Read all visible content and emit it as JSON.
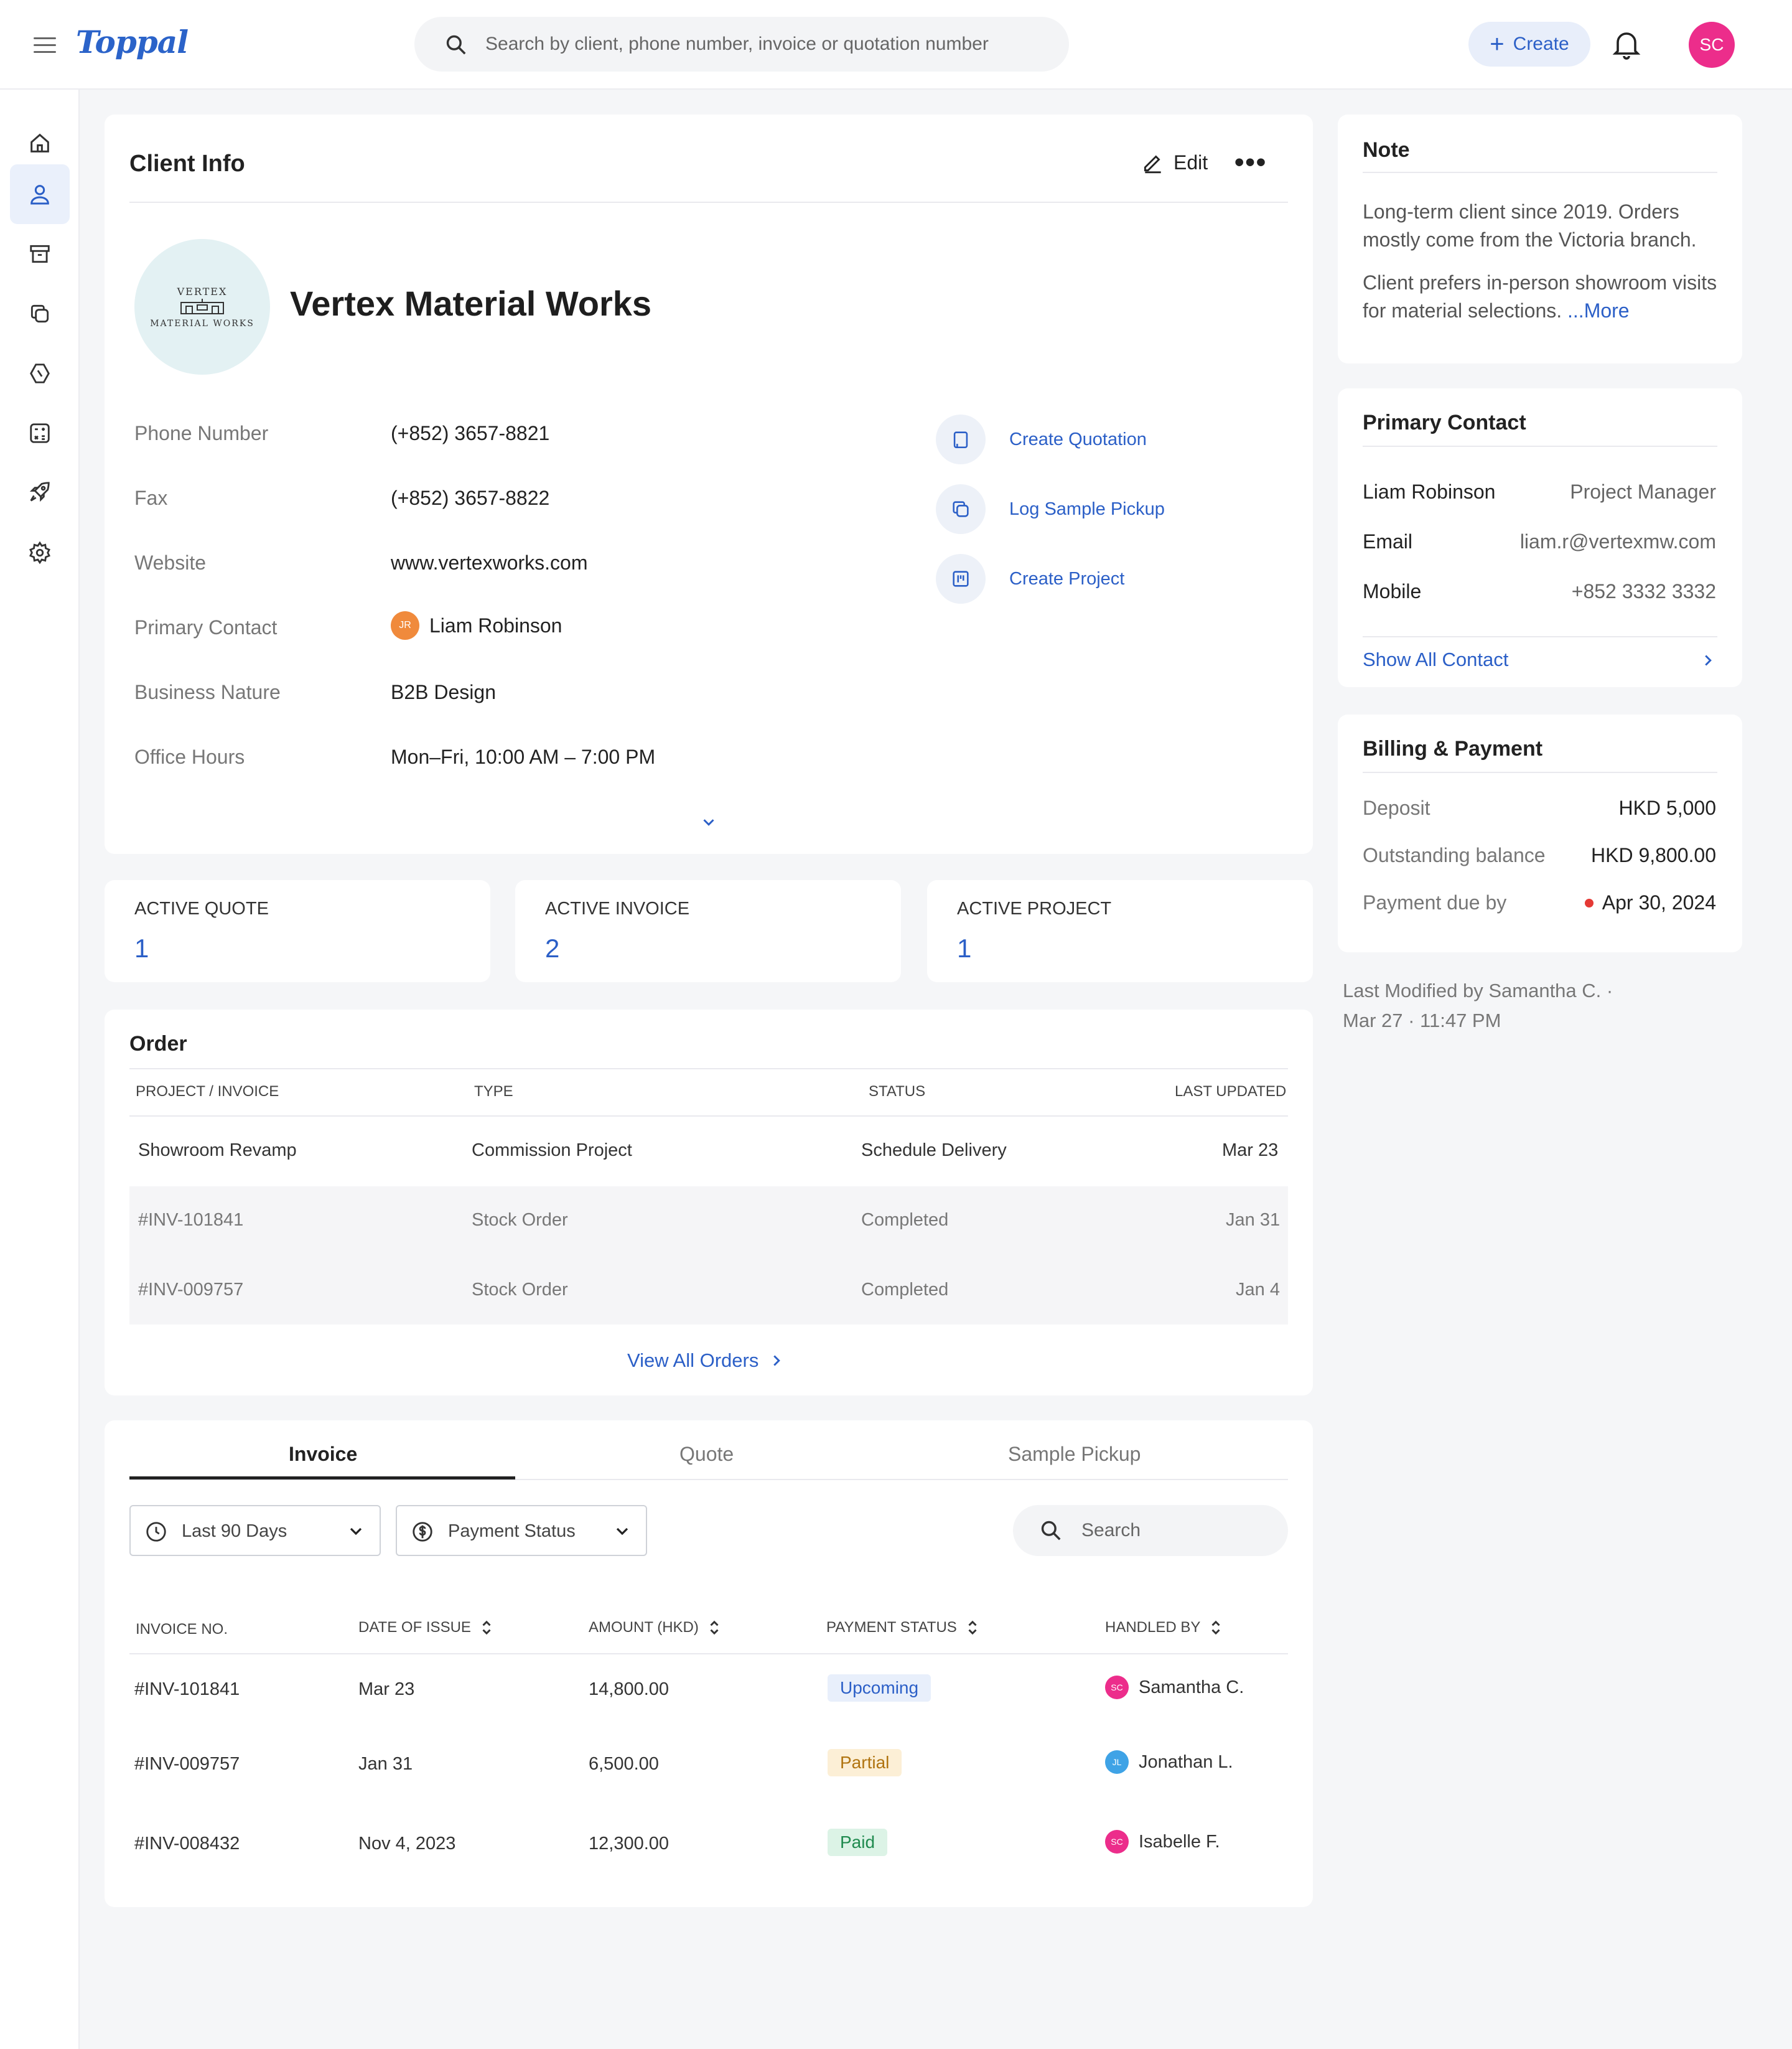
{
  "app": {
    "logo": "Toppal",
    "search_placeholder": "Search by client, phone number, invoice or quotation number",
    "create_label": "Create",
    "user_initials": "SC"
  },
  "sidebar": {
    "items": [
      {
        "icon": "home-icon"
      },
      {
        "icon": "user-icon",
        "active": true
      },
      {
        "icon": "archive-icon"
      },
      {
        "icon": "copy-icon"
      },
      {
        "icon": "tag-icon"
      },
      {
        "icon": "calculator-icon"
      },
      {
        "icon": "rocket-icon"
      },
      {
        "icon": "gear-icon"
      }
    ]
  },
  "client_info": {
    "title": "Client Info",
    "edit_label": "Edit",
    "logo_line1": "VERTEX",
    "logo_line2": "MATERIAL WORKS",
    "name": "Vertex Material Works",
    "fields": [
      {
        "label": "Phone Number",
        "value": "(+852) 3657-8821"
      },
      {
        "label": "Fax",
        "value": "(+852) 3657-8822"
      },
      {
        "label": "Website",
        "value": "www.vertexworks.com"
      },
      {
        "label": "Primary Contact",
        "value": "Liam Robinson",
        "avatar": "JR"
      },
      {
        "label": "Business Nature",
        "value": "B2B Design"
      },
      {
        "label": "Office Hours",
        "value": "Mon–Fri, 10:00 AM – 7:00 PM"
      }
    ],
    "actions": [
      "Create Quotation",
      "Log Sample Pickup",
      "Create Project"
    ]
  },
  "stats": [
    {
      "label": "ACTIVE  QUOTE",
      "value": "1"
    },
    {
      "label": "ACTIVE INVOICE",
      "value": "2"
    },
    {
      "label": "ACTIVE PROJECT",
      "value": "1"
    }
  ],
  "order": {
    "title": "Order",
    "columns": [
      "PROJECT / INVOICE",
      "TYPE",
      "STATUS",
      "LAST UPDATED"
    ],
    "rows": [
      [
        "Showroom Revamp",
        "Commission Project",
        "Schedule Delivery",
        "Mar 23"
      ],
      [
        "#INV-101841",
        "Stock Order",
        "Completed",
        "Jan 31"
      ],
      [
        "#INV-009757",
        "Stock Order",
        "Completed",
        "Jan 4"
      ]
    ],
    "view_all": "View All Orders"
  },
  "docs": {
    "tabs": [
      "Invoice",
      "Quote",
      "Sample  Pickup"
    ],
    "filter_date": "Last 90 Days",
    "filter_status": "Payment Status",
    "search_placeholder": "Search",
    "columns": [
      "INVOICE NO.",
      "DATE OF ISSUE",
      "AMOUNT (HKD)",
      "PAYMENT STATUS",
      "HANDLED BY"
    ],
    "rows": [
      {
        "no": "#INV-101841",
        "date": "Mar 23",
        "amount": "14,800.00",
        "status": "Upcoming",
        "handler": "Samantha C.",
        "initials": "SC"
      },
      {
        "no": "#INV-009757",
        "date": "Jan 31",
        "amount": "6,500.00",
        "status": "Partial",
        "handler": "Jonathan L.",
        "initials": "JL"
      },
      {
        "no": "#INV-008432",
        "date": "Nov 4, 2023",
        "amount": "12,300.00",
        "status": "Paid",
        "handler": "Isabelle F.",
        "initials": "SC"
      }
    ]
  },
  "note": {
    "title": "Note",
    "p1": "Long-term client since 2019. Orders mostly come from the Victoria branch.",
    "p2": "Client prefers in-person showroom visits for material selections. ",
    "more": "...More"
  },
  "primary_contact": {
    "title": "Primary Contact",
    "name": "Liam Robinson",
    "role": "Project Manager",
    "email_label": "Email",
    "email": "liam.r@vertexmw.com",
    "mobile_label": "Mobile",
    "mobile": "+852 3332 3332",
    "show_all": "Show All Contact"
  },
  "billing": {
    "title": "Billing & Payment",
    "deposit_label": "Deposit",
    "deposit": "HKD 5,000",
    "outstanding_label": "Outstanding balance",
    "outstanding": "HKD 9,800.00",
    "due_label": "Payment due by",
    "due": "Apr 30, 2024"
  },
  "modified": {
    "line1": "Last Modified by Samantha C.  ·",
    "line2": "Mar 27  ·  11:47 PM"
  },
  "colors": {
    "accent": "#2b5fc7",
    "upcoming_bg": "#e8effb",
    "partial_bg": "#fcefd6",
    "paid_bg": "#dcf3e6"
  }
}
